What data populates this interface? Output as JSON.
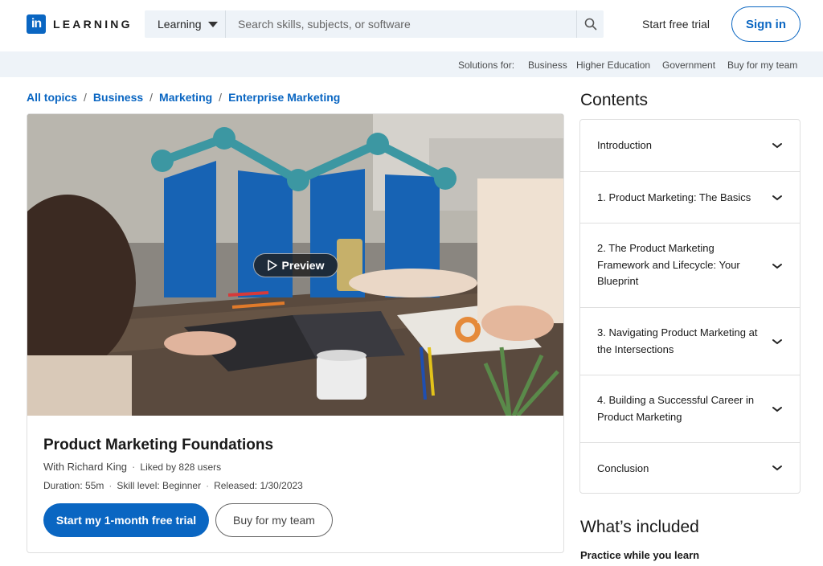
{
  "header": {
    "logo_mark": "in",
    "logo_word": "LEARNING",
    "search_category": "Learning",
    "search_placeholder": "Search skills, subjects, or software",
    "start_trial": "Start free trial",
    "sign_in": "Sign in"
  },
  "subnav": {
    "label": "Solutions for:",
    "links": [
      "Business",
      "Higher Education",
      "Government",
      "Buy for my team"
    ]
  },
  "breadcrumb": [
    "All topics",
    "Business",
    "Marketing",
    "Enterprise Marketing"
  ],
  "course": {
    "preview_label": "Preview",
    "title": "Product Marketing Foundations",
    "instructor": "With Richard King",
    "likes": "Liked by 828 users",
    "duration": "Duration: 55m",
    "skill_level": "Skill level: Beginner",
    "released": "Released: 1/30/2023",
    "primary_cta": "Start my 1-month free trial",
    "secondary_cta": "Buy for my team"
  },
  "contents": {
    "title": "Contents",
    "items": [
      "Introduction",
      "1. Product Marketing: The Basics",
      "2. The Product Marketing Framework and Lifecycle: Your Blueprint",
      "3. Navigating Product Marketing at the Intersections",
      "4. Building a Successful Career in Product Marketing",
      "Conclusion"
    ]
  },
  "included": {
    "title": "What’s included",
    "first_item": "Practice while you learn"
  },
  "colors": {
    "brand": "#0a66c2",
    "subnav_bg": "#eef3f8"
  },
  "icons": {
    "search": "search-icon",
    "caret": "caret-down-icon",
    "chevron": "chevron-down-icon",
    "play": "play-icon"
  }
}
